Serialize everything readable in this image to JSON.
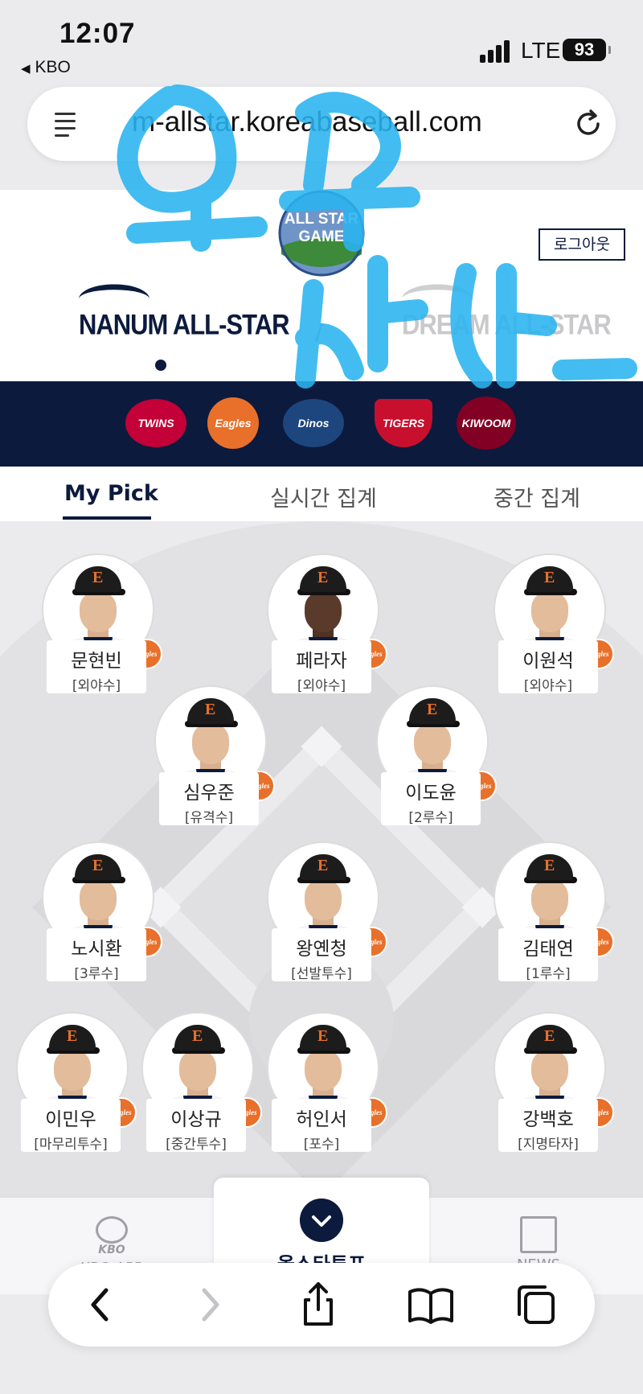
{
  "status_bar": {
    "time": "12:07",
    "back_app": "KBO",
    "network": "LTE",
    "battery": "93"
  },
  "browser": {
    "url": "m-allstar.koreabaseball.com",
    "reader_icon": "reader-mode-icon",
    "reload_icon": "reload-icon"
  },
  "header": {
    "logo_text": [
      "ALL STAR",
      "GAME"
    ],
    "logout_label": "로그아웃",
    "nanum_label": "NANUM ALL-STAR",
    "dream_label": "DREAM ALL-STAR",
    "divider": "/"
  },
  "teams": [
    {
      "name": "TWINS",
      "color": "#c30037"
    },
    {
      "name": "Eagles",
      "color": "#e8702a"
    },
    {
      "name": "Dinos",
      "color": "#1d467e"
    },
    {
      "name": "TIGERS",
      "color": "#c8102e"
    },
    {
      "name": "KIWOOM",
      "color": "#820024"
    }
  ],
  "tabs": {
    "my_pick": "My Pick",
    "realtime": "실시간 집계",
    "interim": "중간 집계"
  },
  "players": [
    {
      "name": "문현빈",
      "position": "[외야수]"
    },
    {
      "name": "페라자",
      "position": "[외야수]"
    },
    {
      "name": "이원석",
      "position": "[외야수]"
    },
    {
      "name": "심우준",
      "position": "[유격수]"
    },
    {
      "name": "이도윤",
      "position": "[2루수]"
    },
    {
      "name": "노시환",
      "position": "[3루수]"
    },
    {
      "name": "왕옌청",
      "position": "[선발투수]"
    },
    {
      "name": "김태연",
      "position": "[1루수]"
    },
    {
      "name": "이민우",
      "position": "[마무리투수]"
    },
    {
      "name": "이상규",
      "position": "[중간투수]"
    },
    {
      "name": "허인서",
      "position": "[포수]"
    },
    {
      "name": "강백호",
      "position": "[지명타자]"
    }
  ],
  "badge_text": "Eagles",
  "app_nav": {
    "kbo_mark": "KBO",
    "kbo_app": "KBO APP",
    "center": "올스타투표",
    "news": "NEWS"
  },
  "colors": {
    "navy": "#0c1a3d",
    "eagles_orange": "#e8702a",
    "scribble_blue": "#2ab4f0"
  }
}
